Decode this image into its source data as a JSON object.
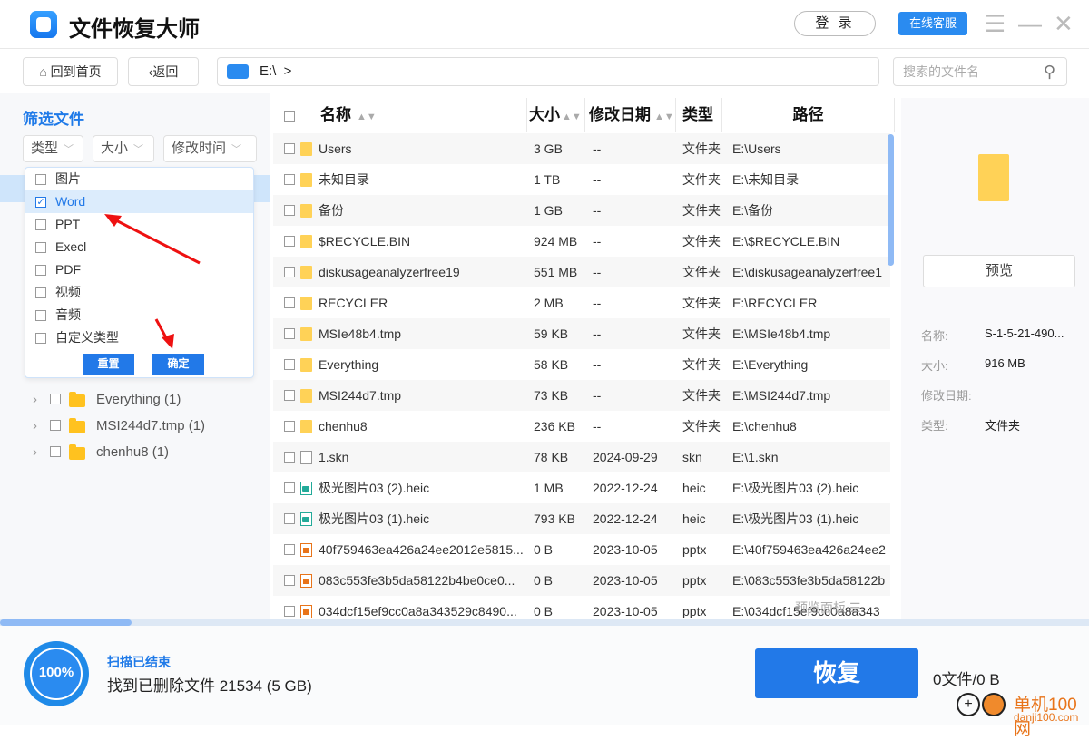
{
  "app": {
    "title": "文件恢复大师",
    "login": "登 录",
    "support": "在线客服"
  },
  "nav": {
    "home": "回到首页",
    "back": "返回",
    "path": "E:\\  >",
    "search_placeholder": "搜索的文件名"
  },
  "filter": {
    "title": "筛选文件",
    "type": "类型",
    "size": "大小",
    "mtime": "修改时间",
    "options": [
      {
        "label": "图片",
        "checked": false
      },
      {
        "label": "Word",
        "checked": true
      },
      {
        "label": "PPT",
        "checked": false
      },
      {
        "label": "Execl",
        "checked": false
      },
      {
        "label": "PDF",
        "checked": false
      },
      {
        "label": "视频",
        "checked": false
      },
      {
        "label": "音频",
        "checked": false
      },
      {
        "label": "自定义类型",
        "checked": false
      }
    ],
    "reset": "重置",
    "confirm": "确定"
  },
  "tree": [
    {
      "label": "Everything (1)"
    },
    {
      "label": "MSI244d7.tmp (1)"
    },
    {
      "label": "chenhu8 (1)"
    }
  ],
  "table": {
    "headers": {
      "name": "名称",
      "size": "大小",
      "date": "修改日期",
      "type": "类型",
      "path": "路径"
    },
    "rows": [
      {
        "icon": "folder",
        "name": "Users",
        "size": "3 GB",
        "date": "--",
        "type": "文件夹",
        "path": "E:\\Users"
      },
      {
        "icon": "folder",
        "name": "未知目录",
        "size": "1 TB",
        "date": "--",
        "type": "文件夹",
        "path": "E:\\未知目录"
      },
      {
        "icon": "folder",
        "name": "备份",
        "size": "1 GB",
        "date": "--",
        "type": "文件夹",
        "path": "E:\\备份"
      },
      {
        "icon": "folder",
        "name": "$RECYCLE.BIN",
        "size": "924 MB",
        "date": "--",
        "type": "文件夹",
        "path": "E:\\$RECYCLE.BIN"
      },
      {
        "icon": "folder",
        "name": "diskusageanalyzerfree19",
        "size": "551 MB",
        "date": "--",
        "type": "文件夹",
        "path": "E:\\diskusageanalyzerfree1"
      },
      {
        "icon": "folder",
        "name": "RECYCLER",
        "size": "2 MB",
        "date": "--",
        "type": "文件夹",
        "path": "E:\\RECYCLER"
      },
      {
        "icon": "folder",
        "name": "MSIe48b4.tmp",
        "size": "59 KB",
        "date": "--",
        "type": "文件夹",
        "path": "E:\\MSIe48b4.tmp"
      },
      {
        "icon": "folder",
        "name": "Everything",
        "size": "58 KB",
        "date": "--",
        "type": "文件夹",
        "path": "E:\\Everything"
      },
      {
        "icon": "folder",
        "name": "MSI244d7.tmp",
        "size": "73 KB",
        "date": "--",
        "type": "文件夹",
        "path": "E:\\MSI244d7.tmp"
      },
      {
        "icon": "folder",
        "name": "chenhu8",
        "size": "236 KB",
        "date": "--",
        "type": "文件夹",
        "path": "E:\\chenhu8"
      },
      {
        "icon": "file",
        "name": "1.skn",
        "size": "78 KB",
        "date": "2024-09-29",
        "type": "skn",
        "path": "E:\\1.skn"
      },
      {
        "icon": "heic",
        "name": "极光图片03 (2).heic",
        "size": "1 MB",
        "date": "2022-12-24",
        "type": "heic",
        "path": "E:\\极光图片03 (2).heic"
      },
      {
        "icon": "heic",
        "name": "极光图片03 (1).heic",
        "size": "793 KB",
        "date": "2022-12-24",
        "type": "heic",
        "path": "E:\\极光图片03 (1).heic"
      },
      {
        "icon": "pptx",
        "name": "40f759463ea426a24ee2012e5815...",
        "size": "0 B",
        "date": "2023-10-05",
        "type": "pptx",
        "path": "E:\\40f759463ea426a24ee2"
      },
      {
        "icon": "pptx",
        "name": "083c553fe3b5da58122b4be0ce0...",
        "size": "0 B",
        "date": "2023-10-05",
        "type": "pptx",
        "path": "E:\\083c553fe3b5da58122b"
      },
      {
        "icon": "pptx",
        "name": "034dcf15ef9cc0a8a343529c8490...",
        "size": "0 B",
        "date": "2023-10-05",
        "type": "pptx",
        "path": "E:\\034dcf15ef9cc0a8a343"
      }
    ],
    "overlay": "预览面板 ☰"
  },
  "preview": {
    "button": "预览",
    "fields": [
      {
        "label": "名称:",
        "value": "S-1-5-21-490..."
      },
      {
        "label": "大小:",
        "value": "916 MB"
      },
      {
        "label": "修改日期:",
        "value": ""
      },
      {
        "label": "类型:",
        "value": "文件夹"
      }
    ]
  },
  "footer": {
    "progress": "100%",
    "status": "扫描已结束",
    "found": "找到已删除文件 21534 (5 GB)",
    "recover": "恢复",
    "selected": "0文件/0 B"
  },
  "watermark": {
    "name": "单机100网",
    "url": "danji100.com"
  },
  "colors": {
    "accent": "#2279e8"
  }
}
